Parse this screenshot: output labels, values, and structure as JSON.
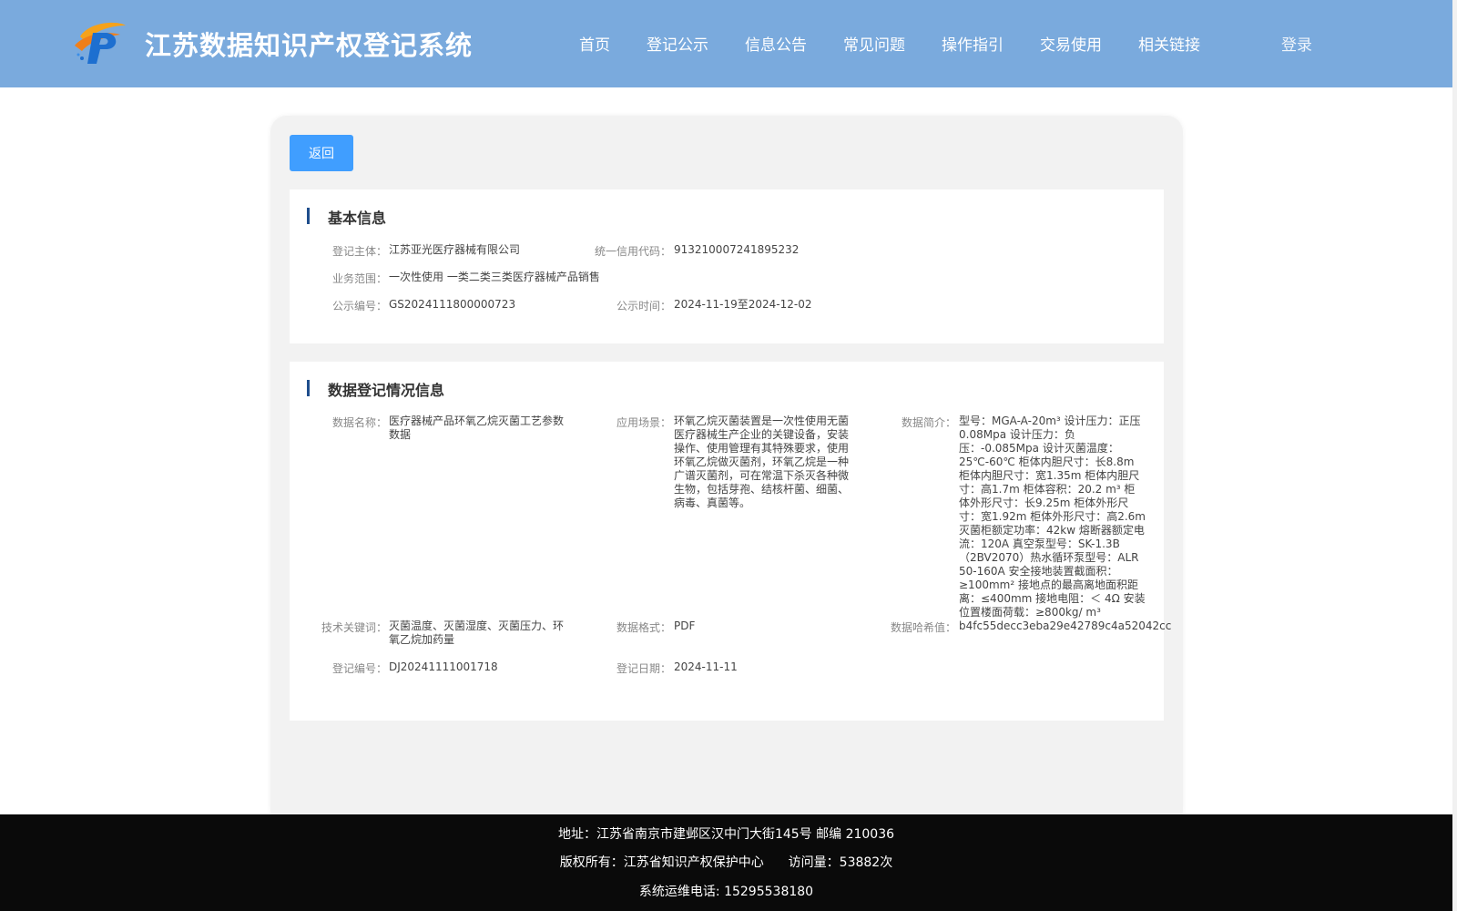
{
  "header": {
    "title": "江苏数据知识产权登记系统",
    "nav": [
      "首页",
      "登记公示",
      "信息公告",
      "常见问题",
      "操作指引",
      "交易使用",
      "相关链接"
    ],
    "login": "登录"
  },
  "back_button": "返回",
  "basic": {
    "section_title": "基本信息",
    "subject_label": "登记主体：",
    "subject": "江苏亚光医疗器械有限公司",
    "credit_label": "统一信用代码：",
    "credit": "913210007241895232",
    "scope_label": "业务范围：",
    "scope": "一次性使用 一类二类三类医疗器械产品销售",
    "notice_no_label": "公示编号：",
    "notice_no": "GS2024111800000723",
    "notice_time_label": "公示时间：",
    "notice_time": "2024-11-19至2024-12-02"
  },
  "registration": {
    "section_title": "数据登记情况信息",
    "data_name_label": "数据名称：",
    "data_name": "医疗器械产品环氧乙烷灭菌工艺参数数据",
    "scenario_label": "应用场景：",
    "scenario": "环氧乙烷灭菌装置是一次性使用无菌医疗器械生产企业的关键设备，安装操作、使用管理有其特殊要求，使用环氧乙烷做灭菌剂，环氧乙烷是一种广谱灭菌剂，可在常温下杀灭各种微生物，包括芽孢、结核杆菌、细菌、病毒、真菌等。",
    "intro_label": "数据简介：",
    "intro": "型号：MGA-A-20m³ 设计压力：正压0.08Mpa 设计压力：负压：-0.085Mpa 设计灭菌温度：25℃-60℃ 柜体内胆尺寸：长8.8m 柜体内胆尺寸：宽1.35m 柜体内胆尺寸：高1.7m 柜体容积：20.2 m³ 柜体外形尺寸：长9.25m 柜体外形尺寸：宽1.92m 柜体外形尺寸：高2.6m 灭菌柜额定功率：42kw 熔断器额定电流：120A 真空泵型号：SK-1.3B（2BV2070）热水循环泵型号：ALR 50-160A 安全接地装置截面积：≥100mm² 接地点的最高离地面积距离：≤400mm 接地电阻：＜ 4Ω 安装位置楼面荷载：≥800kg/ m³",
    "keywords_label": "技术关键词：",
    "keywords": "灭菌温度、灭菌湿度、灭菌压力、环氧乙烷加药量",
    "format_label": "数据格式：",
    "format": "PDF",
    "hash_label": "数据哈希值：",
    "hash": "b4fc55decc3eba29e42789c4a52042cc",
    "reg_no_label": "登记编号：",
    "reg_no": "DJ20241111001718",
    "reg_date_label": "登记日期：",
    "reg_date": "2024-11-11"
  },
  "footer": {
    "address": "地址：江苏省南京市建邺区汉中门大街145号 邮编 210036",
    "copyright": "版权所有：江苏省知识产权保护中心",
    "visits": "访问量：53882次",
    "phone": "系统运维电话: 15295538180"
  }
}
